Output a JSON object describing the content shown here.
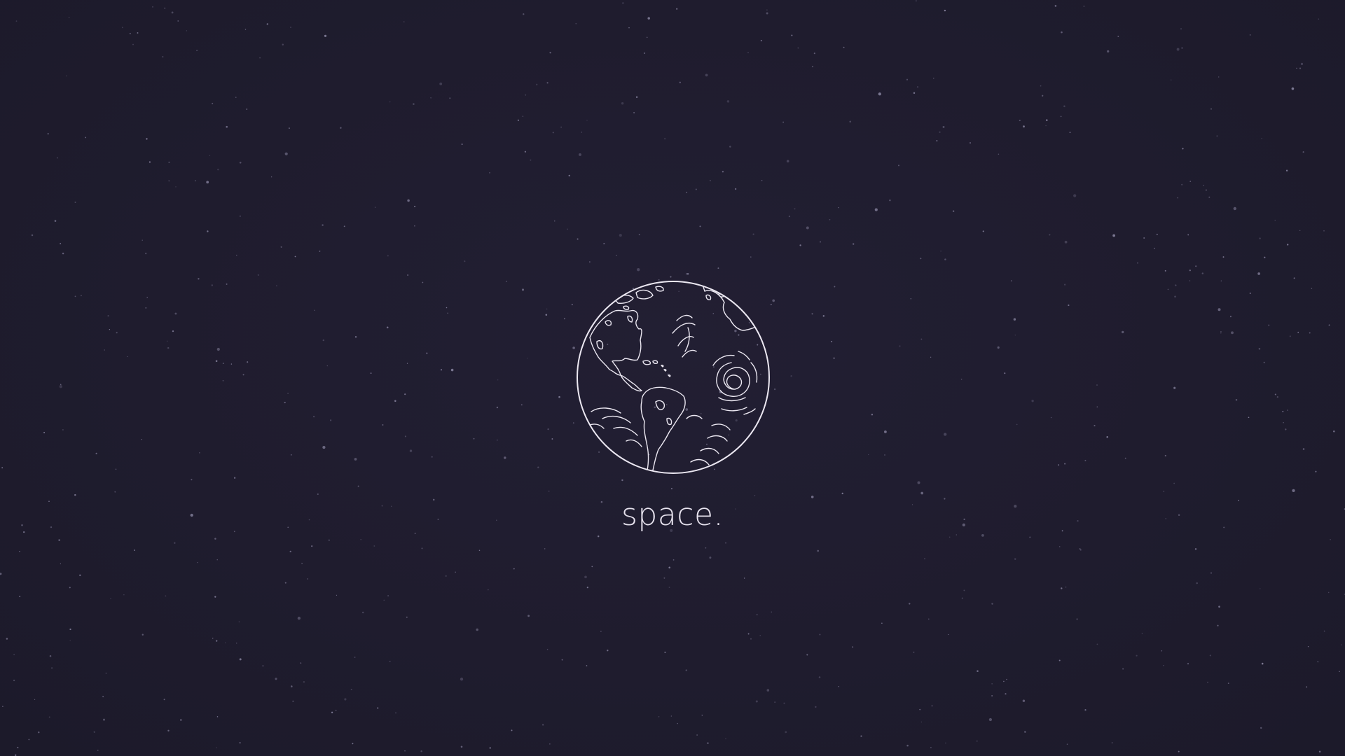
{
  "caption": "space.",
  "icons": {
    "globe": "earth-globe-icon"
  },
  "colors": {
    "background": "#1f1c2e",
    "line": "#ece8f2",
    "stars": "#8e8aa6"
  }
}
